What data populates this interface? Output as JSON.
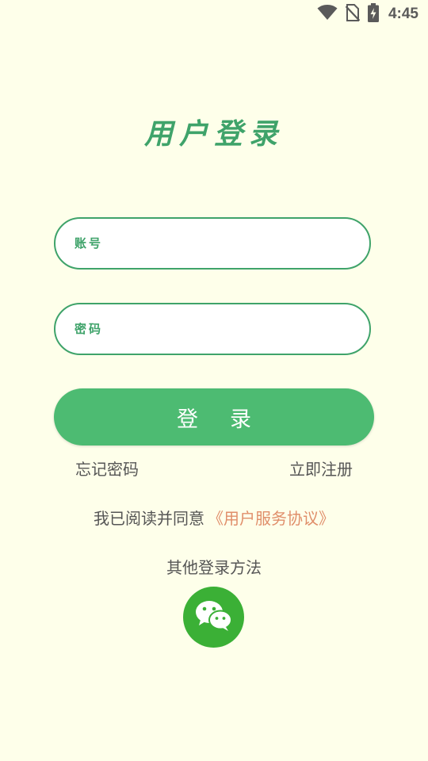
{
  "status_bar": {
    "time": "4:45",
    "icons": [
      "wifi-icon",
      "no-sim-icon",
      "battery-charging-icon"
    ]
  },
  "title": "用户登录",
  "account_field": {
    "placeholder": "账号",
    "value": ""
  },
  "password_field": {
    "placeholder": "密码",
    "value": ""
  },
  "login_button": {
    "label": "登录"
  },
  "links": {
    "forgot_password": "忘记密码",
    "register": "立即注册"
  },
  "agreement": {
    "prefix": "我已阅读并同意",
    "link": "《用户服务协议》"
  },
  "other_login": {
    "label": "其他登录方法",
    "methods": [
      "wechat-icon"
    ]
  },
  "colors": {
    "background": "#FEFFEA",
    "accent": "#4DBB72",
    "title_green": "#3FA36A",
    "link_orange": "#E08E6A",
    "wechat_green": "#3BB036"
  }
}
